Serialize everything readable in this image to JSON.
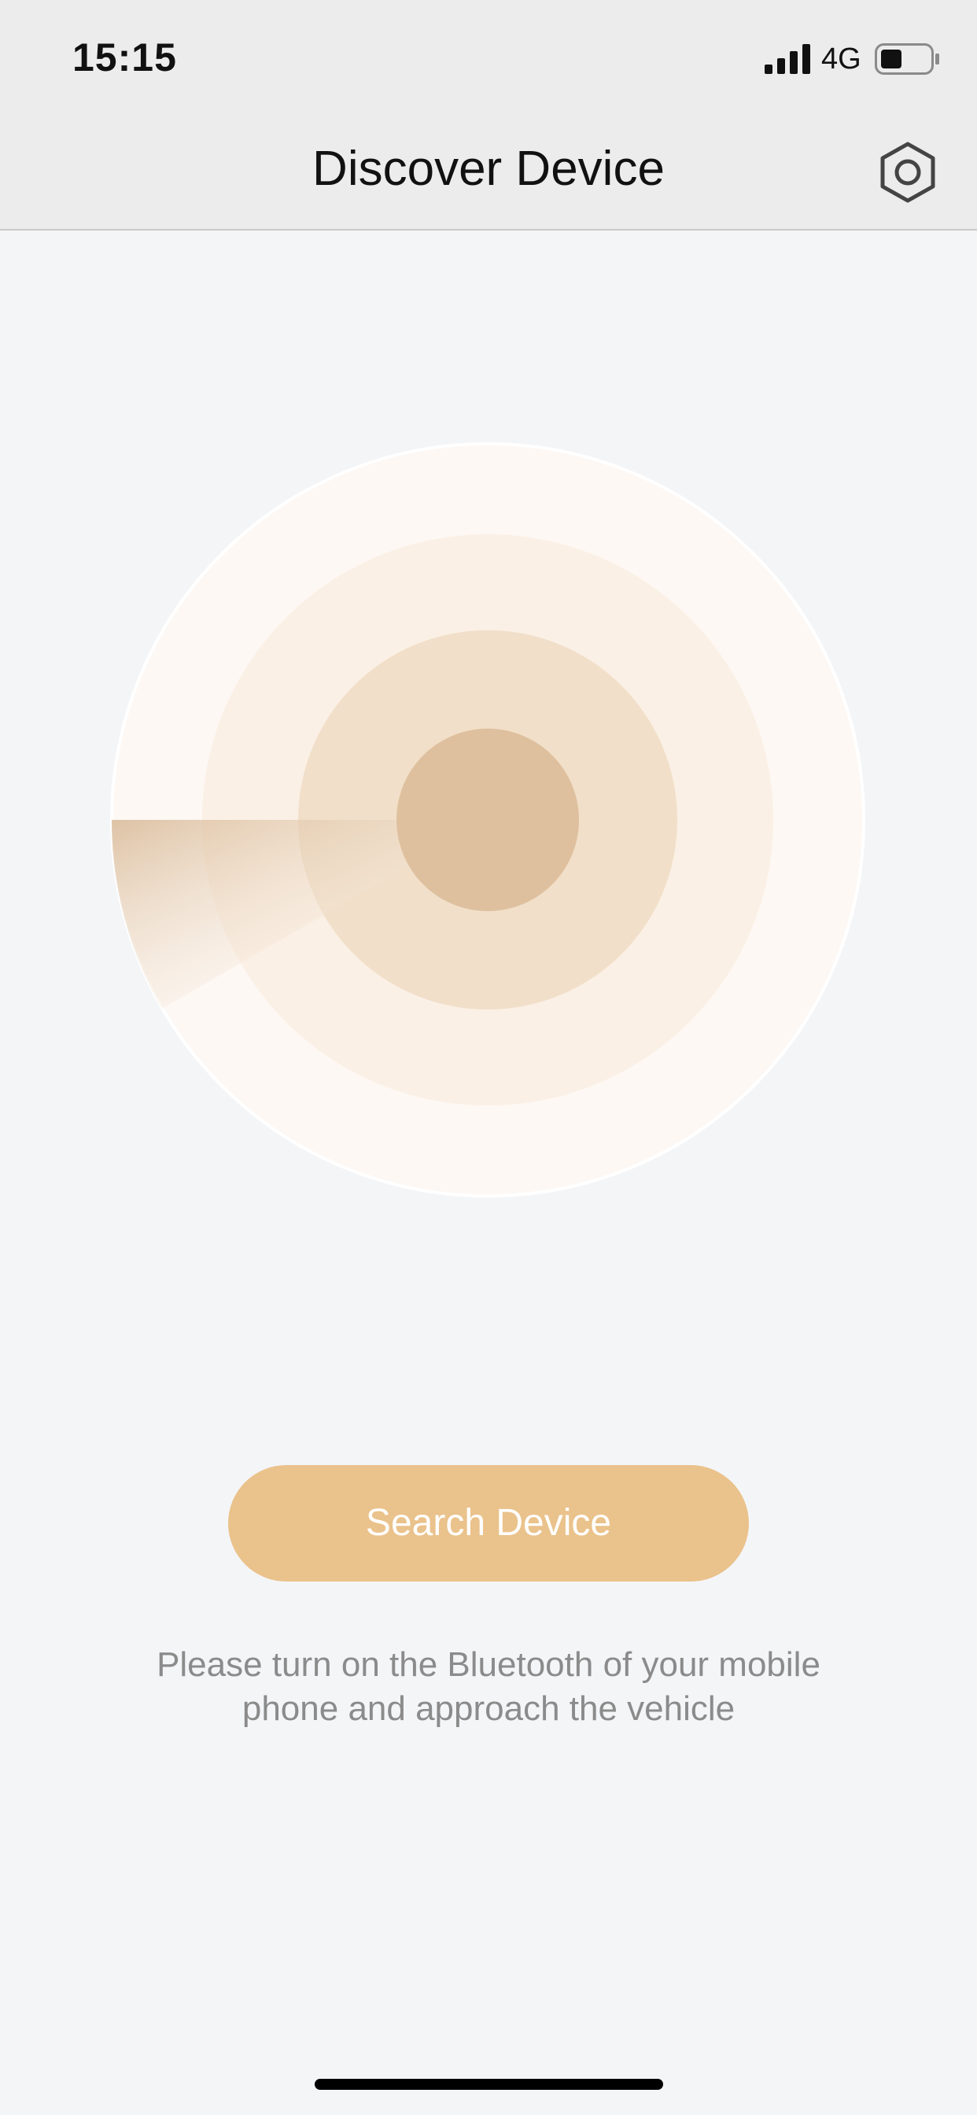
{
  "status_bar": {
    "time": "15:15",
    "network": "4G",
    "icons": [
      "signal-icon",
      "battery-icon"
    ]
  },
  "header": {
    "title": "Discover Device",
    "settings_icon": "hexagon-settings-icon"
  },
  "radar": {
    "icon": "radar-scan-icon",
    "colors": {
      "outer": "#fdf8f4",
      "middle": "#fbf0e5",
      "inner": "#f1dfc9",
      "core": "#dfc09e",
      "sweep": "#d7b793"
    }
  },
  "search_button": {
    "label": "Search Device",
    "color": "#eac28b"
  },
  "hint": {
    "line1": "Please turn on the Bluetooth of your mobile",
    "line2": "phone and approach the vehicle"
  }
}
